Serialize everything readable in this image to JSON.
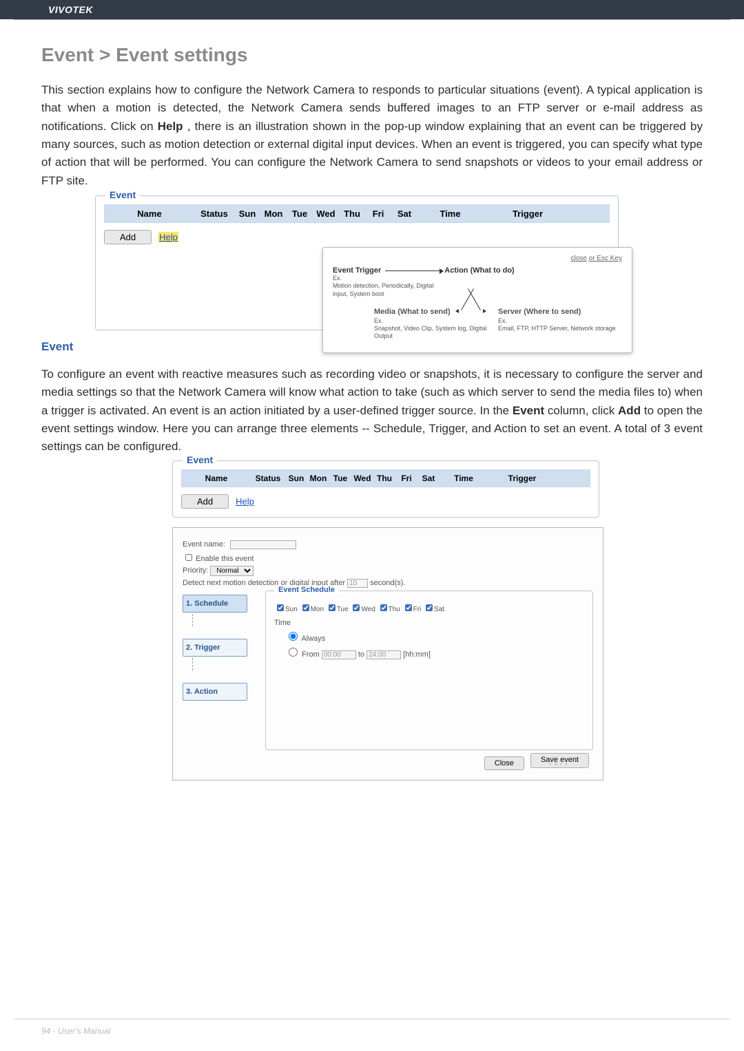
{
  "brand": "VIVOTEK",
  "heading": "Event > Event settings",
  "intro_before_help": "This section explains how to configure the Network Camera to responds to particular situations (event). A typical application is that when a motion is detected, the Network Camera sends buffered images to an FTP server or e-mail address as notifications. Click on ",
  "intro_help_word": "Help",
  "intro_after_help": ", there is an illustration shown in the pop-up window explaining that an event can be triggered by many sources, such as motion detection or external digital input devices. When an event is triggered, you can specify what type of action that will be performed. You can configure the Network Camera to send snapshots or videos to your email address or FTP site.",
  "event_panel": {
    "legend": "Event",
    "columns": {
      "name": "Name",
      "status": "Status",
      "sun": "Sun",
      "mon": "Mon",
      "tue": "Tue",
      "wed": "Wed",
      "thu": "Thu",
      "fri": "Fri",
      "sat": "Sat",
      "time": "Time",
      "trigger": "Trigger"
    },
    "add_label": "Add",
    "help_label": "Help"
  },
  "diagram": {
    "close_prefix": "close",
    "close_suffix": " or Esc Key",
    "trigger_title": "Event Trigger",
    "trigger_ex": "Ex.",
    "trigger_body": "Motion detection, Periodically, Digital input, System boot",
    "action_title": "Action (What to do)",
    "media_title": "Media (What to send)",
    "media_ex": "Ex.",
    "media_body": "Snapshot, Video Clip, System log, Digital Output",
    "server_title": "Server (Where to send)",
    "server_ex": "Ex.",
    "server_body": "Email, FTP, HTTP Server, Network storage"
  },
  "sh_event": "Event",
  "para2_before": "To configure an event with reactive measures such as recording video or snapshots, it is necessary to configure the server and media settings so that the Network Camera will know what action to take (such as which server to send the media files to) when a trigger is activated. An event is an action initiated by a user-defined trigger source. In the ",
  "para2_event_word": "Event",
  "para2_mid": " column, click ",
  "para2_add_word": "Add",
  "para2_after": " to open the event settings window. Here you can arrange three elements -- Schedule, Trigger, and Action to set an event. A total of 3 event settings can be configured.",
  "settings": {
    "event_name_label": "Event name:",
    "enable_label": "Enable this event",
    "priority_label": "Priority:",
    "priority_value": "Normal",
    "detect_before": "Detect next motion detection or digital input after",
    "detect_value": "10",
    "detect_after": "second(s).",
    "tab1": "1. Schedule",
    "tab2": "2. Trigger",
    "tab3": "3. Action",
    "schedule_legend": "Event Schedule",
    "days": {
      "sun": "Sun",
      "mon": "Mon",
      "tue": "Tue",
      "wed": "Wed",
      "thu": "Thu",
      "fri": "Fri",
      "sat": "Sat"
    },
    "time_label": "Time",
    "always": "Always",
    "from": "From",
    "to": "to",
    "from_val": "00:00",
    "to_val": "24:00",
    "hhmm": "[hh:mm]",
    "close": "Close",
    "save": "Save event",
    "save_sub": "save"
  },
  "footer": "94 - User's Manual"
}
